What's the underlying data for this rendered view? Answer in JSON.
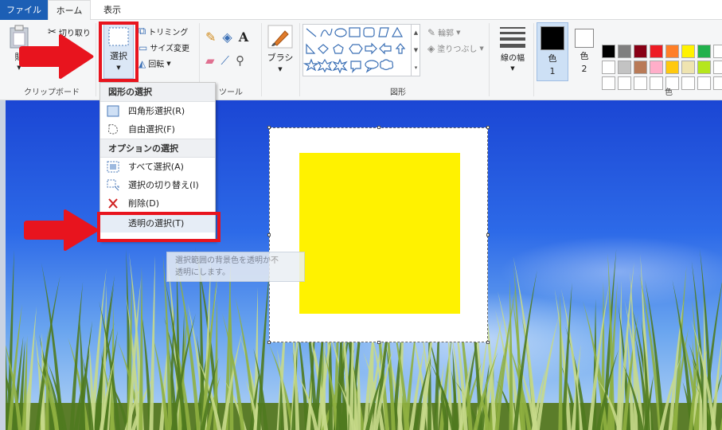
{
  "tabs": {
    "file": "ファイル",
    "home": "ホーム",
    "view": "表示"
  },
  "ribbon": {
    "clipboard": {
      "paste_label": "貼",
      "cut_label": "切り取り",
      "group_label": "クリップボード"
    },
    "image": {
      "select_label": "選択",
      "crop_label": "トリミング",
      "resize_label": "サイズ変更",
      "rotate_label": "回転"
    },
    "tools": {
      "group_label": "ツール"
    },
    "brush": {
      "label": "ブラシ"
    },
    "shapes": {
      "outline_label": "輪郭",
      "fill_label": "塗りつぶし",
      "group_label": "図形"
    },
    "size": {
      "label": "線の幅"
    },
    "colors": {
      "color1_label": "色",
      "color1_num": "1",
      "color2_label": "色",
      "color2_num": "2",
      "group_label": "色",
      "color1_value": "#000000",
      "color2_value": "#ffffff",
      "palette_row1": [
        "#000000",
        "#7f7f7f",
        "#880015",
        "#ed1c24",
        "#ff7f27",
        "#fff200",
        "#22b14c"
      ],
      "palette_row2": [
        "#ffffff",
        "#c3c3c3",
        "#b97a57",
        "#ffaec9",
        "#ffc90e",
        "#efe4b0",
        "#b5e61d"
      ]
    }
  },
  "select_menu": {
    "shape_section": "図形の選択",
    "rect_select": "四角形選択(R)",
    "free_select": "自由選択(F)",
    "options_section": "オプションの選択",
    "select_all": "すべて選択(A)",
    "invert_select": "選択の切り替え(I)",
    "delete": "削除(D)",
    "transparent_select": "透明の選択(T)"
  },
  "tooltip": {
    "line1": "選択範囲の背景色を透明か不",
    "line2": "透明にします。"
  },
  "colors": {
    "annotation": "#e8141e",
    "canvas_shape": "#fff200"
  }
}
